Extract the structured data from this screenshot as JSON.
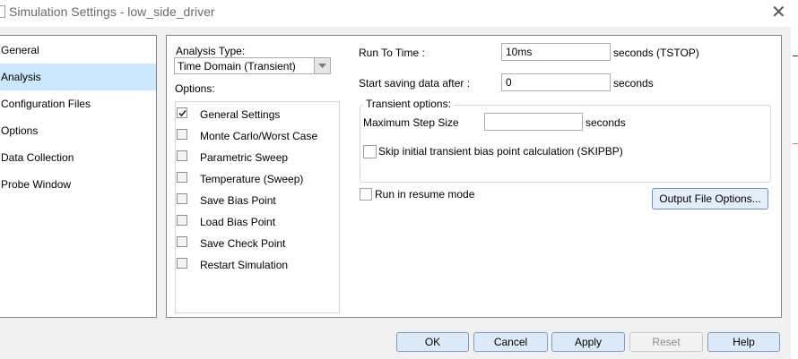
{
  "window": {
    "title": "Simulation Settings - low_side_driver"
  },
  "nav": {
    "items": [
      {
        "label": "General"
      },
      {
        "label": "Analysis"
      },
      {
        "label": "Configuration Files"
      },
      {
        "label": "Options"
      },
      {
        "label": "Data Collection"
      },
      {
        "label": "Probe Window"
      }
    ],
    "selected": "Analysis"
  },
  "analysis": {
    "type_label": "Analysis Type:",
    "type_value": "Time Domain (Transient)",
    "options_label": "Options:",
    "options": [
      {
        "label": "General Settings",
        "checked": true
      },
      {
        "label": "Monte Carlo/Worst Case",
        "checked": false
      },
      {
        "label": "Parametric Sweep",
        "checked": false
      },
      {
        "label": "Temperature (Sweep)",
        "checked": false
      },
      {
        "label": "Save Bias Point",
        "checked": false
      },
      {
        "label": "Load Bias Point",
        "checked": false
      },
      {
        "label": "Save Check Point",
        "checked": false
      },
      {
        "label": "Restart Simulation",
        "checked": false
      }
    ]
  },
  "settings": {
    "run_to_time_label": "Run To Time :",
    "run_to_time_value": "10ms",
    "run_to_time_unit": "seconds (TSTOP)",
    "start_saving_label": "Start saving data after :",
    "start_saving_value": "0",
    "start_saving_unit": "seconds",
    "transient_group_label": "Transient options:",
    "max_step_label": "Maximum Step Size",
    "max_step_value": "",
    "max_step_unit": "seconds",
    "skip_bias_label": "Skip initial transient bias point calculation (SKIPBP)",
    "skip_bias_checked": false,
    "resume_label": "Run in resume mode",
    "resume_checked": false,
    "output_file_button": "Output File Options..."
  },
  "footer": {
    "ok": "OK",
    "cancel": "Cancel",
    "apply": "Apply",
    "reset": "Reset",
    "help": "Help"
  }
}
